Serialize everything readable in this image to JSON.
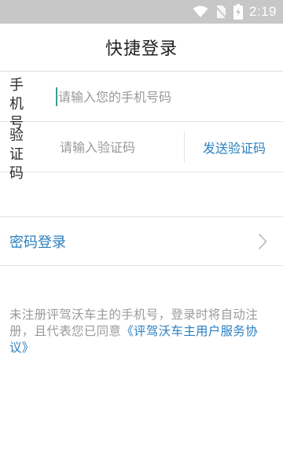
{
  "status_bar": {
    "time": "2:19",
    "icons": [
      "wifi-icon",
      "no-sim-icon",
      "battery-charging-icon"
    ]
  },
  "header": {
    "title": "快捷登录"
  },
  "form": {
    "phone": {
      "label": "手机号",
      "value": "",
      "placeholder": "请输入您的手机号码"
    },
    "code": {
      "label": "验证码",
      "value": "",
      "placeholder": "请输入验证码",
      "send_button": "发送验证码"
    }
  },
  "password_login": {
    "label": "密码登录",
    "icon": "chevron-right-icon"
  },
  "notice": {
    "text": "未注册评驾沃车主的手机号，登录时将自动注册，且代表您已同意",
    "link": "《评驾沃车主用户服务协议》"
  },
  "colors": {
    "status_bar_bg": "#c7c7c7",
    "accent": "#2a7fc0",
    "caret": "#3a9d9d",
    "muted_text": "#9a9a9a"
  }
}
